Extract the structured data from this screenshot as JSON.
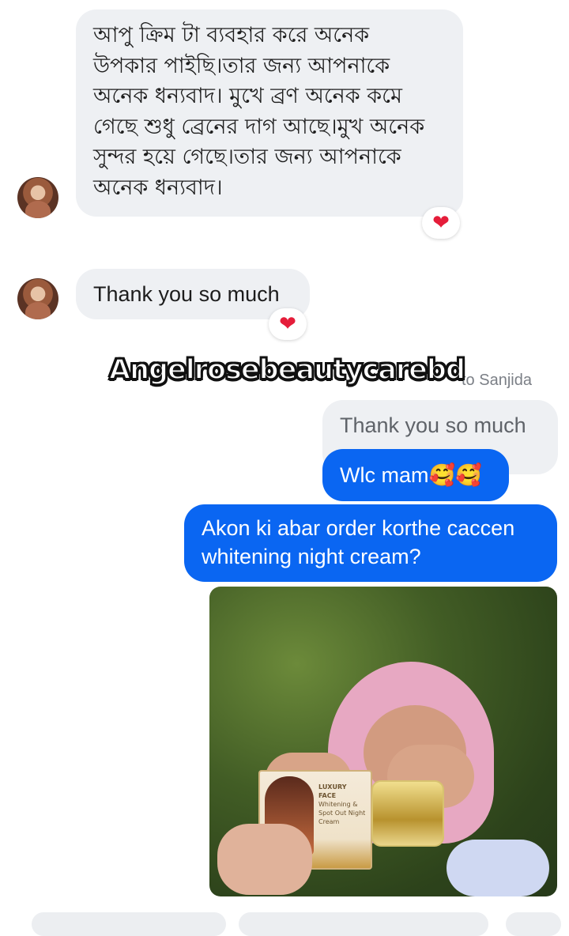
{
  "messages": {
    "incoming_long": {
      "lines": [
        "আপু ক্রিম টা ব্যবহার করে অনেক",
        "উপকার পাইছি।তার জন্য আপনাকে",
        "অনেক ধন্যবাদ। মুখে ব্রণ অনেক কমে",
        "গেছে শুধু ব্রেনের দাগ আছে।মুখ অনেক",
        "সুন্দর হয়ে গেছে।তার জন্য আপনাকে",
        "অনেক ধন্যবাদ।"
      ],
      "reaction": "❤"
    },
    "incoming_short": {
      "text": "Thank you so much",
      "reaction": "❤"
    },
    "reply_context": {
      "meta": "to Sanjida",
      "quoted": "Thank you so much"
    },
    "outgoing_1": {
      "text": "Wlc mam🥰🥰"
    },
    "outgoing_2": {
      "lines": [
        "Akon ki abar order korthe caccen",
        "whitening night cream?"
      ]
    },
    "photo": {
      "brand": "LUXURY FACE",
      "product": "Whitening & Spot Out Night Cream"
    }
  },
  "watermark": "Angelrosebeautycarebd",
  "colors": {
    "outgoing_bubble": "#0a66f2",
    "incoming_bubble": "#eef0f3",
    "reaction_heart": "#e51d3a"
  }
}
